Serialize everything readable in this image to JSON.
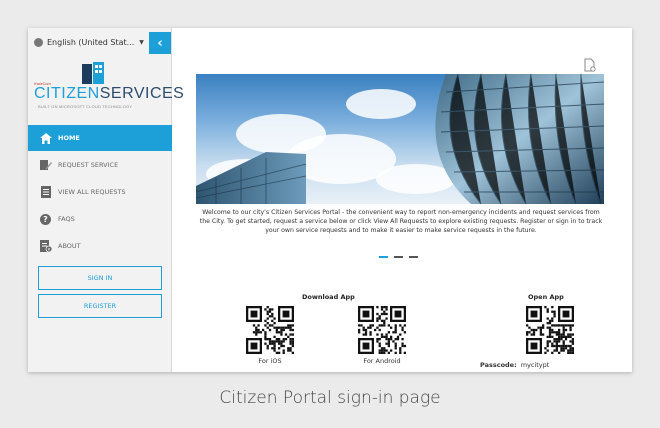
{
  "sidebar": {
    "language": "English (United Stat...",
    "logo": {
      "company": "KwizCom",
      "name_left": "CITIZEN",
      "name_right": "SERVICES",
      "tagline": "BUILT ON MICROSOFT CLOUD TECHNOLOGY"
    },
    "nav": [
      {
        "label": "HOME",
        "icon": "home-icon",
        "active": true
      },
      {
        "label": "REQUEST SERVICE",
        "icon": "edit-icon",
        "active": false
      },
      {
        "label": "VIEW ALL REQUESTS",
        "icon": "document-list-icon",
        "active": false
      },
      {
        "label": "FAQS",
        "icon": "question-icon",
        "active": false
      },
      {
        "label": "ABOUT",
        "icon": "info-document-icon",
        "active": false
      }
    ],
    "sign_in": "SIGN IN",
    "register": "REGISTER"
  },
  "main": {
    "welcome": "Welcome to our city's Citizen Services Portal - the convenient way to report non-emergency incidents and request services from the City. To get started, request a service below or click View All Requests to explore existing requests. Register or sign in to track your own service requests and to make it easier to make service requests in the future.",
    "carousel_slides": 3,
    "download_app_heading": "Download App",
    "open_app_heading": "Open App",
    "ios_label": "For iOS",
    "android_label": "For Android",
    "passcode_label": "Passcode:",
    "passcode_value": "mycitypt"
  },
  "caption": "Citizen Portal sign-in page",
  "colors": {
    "accent": "#1d9fd8",
    "logo_dark": "#2d4d6d",
    "page_bg": "#ebebeb"
  }
}
